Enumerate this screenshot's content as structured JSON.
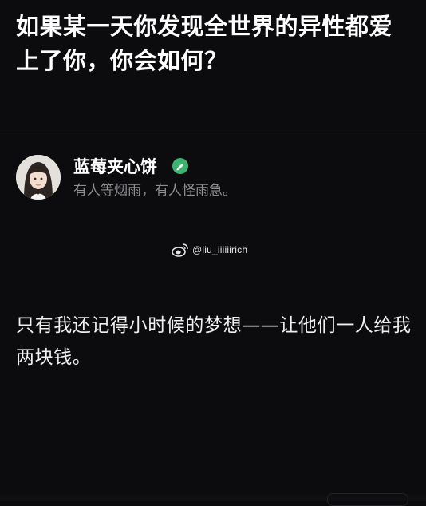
{
  "question": {
    "title": "如果某一天你发现全世界的异性都爱上了你，你会如何？"
  },
  "answer": {
    "author": {
      "name": "蓝莓夹心饼",
      "bio": "有人等烟雨，有人怪雨急。",
      "avatar_icon": "avatar-girl",
      "verified_icon": "verified-badge-icon",
      "verified_color": "#3cb371"
    },
    "watermark": {
      "icon": "weibo-icon",
      "text": "@liu_iiiiiirich"
    },
    "body": "只有我还记得小时候的梦想——让他们一人给我两块钱。"
  },
  "colors": {
    "background": "#0c0c0e",
    "primary_text": "#ffffff",
    "secondary_text": "#8e8e93"
  }
}
